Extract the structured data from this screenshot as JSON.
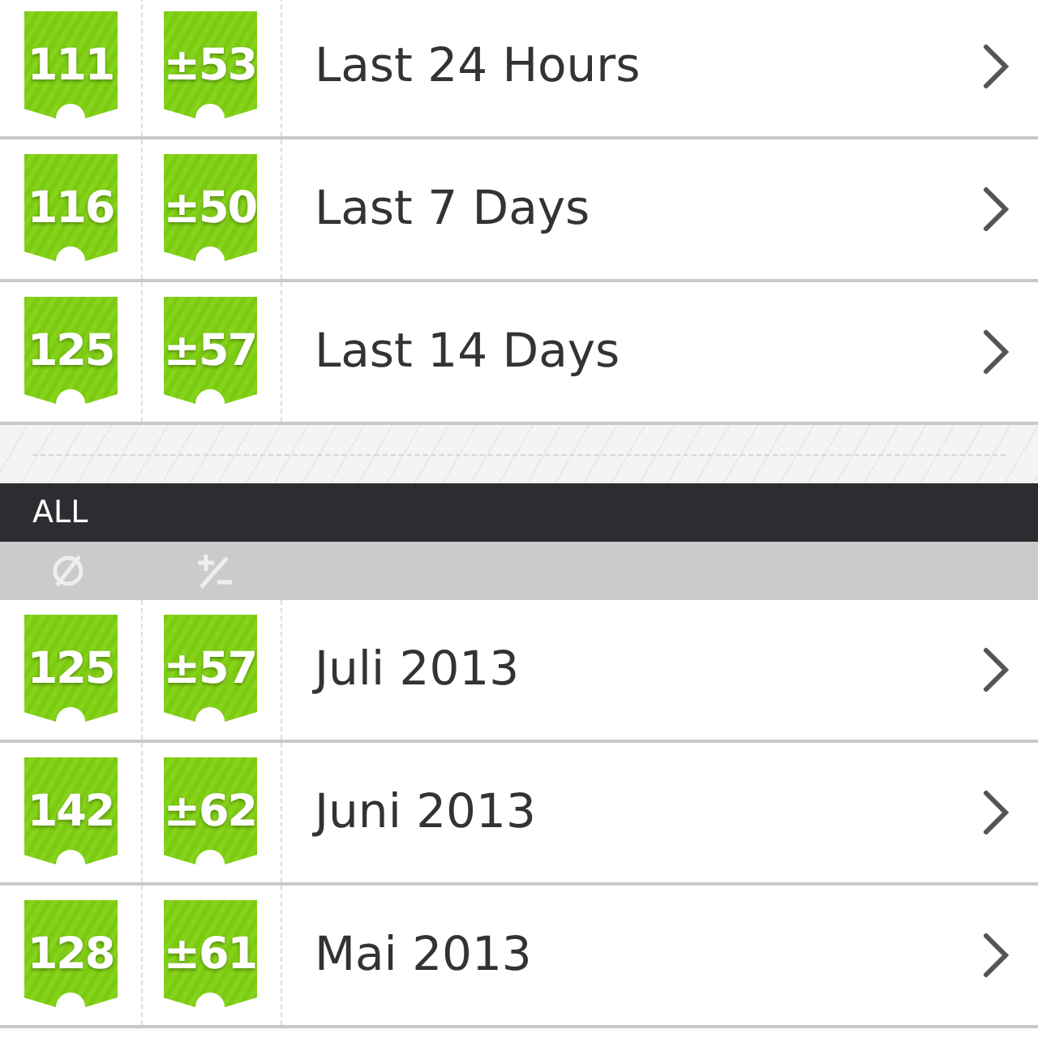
{
  "recent_rows": [
    {
      "average": "111",
      "deviation": "±53",
      "label": "Last 24 Hours"
    },
    {
      "average": "116",
      "deviation": "±50",
      "label": "Last 7 Days"
    },
    {
      "average": "125",
      "deviation": "±57",
      "label": "Last 14 Days"
    }
  ],
  "section_header": {
    "title": "ALL"
  },
  "month_rows": [
    {
      "average": "125",
      "deviation": "±57",
      "label": "Juli 2013"
    },
    {
      "average": "142",
      "deviation": "±62",
      "label": "Juni 2013"
    },
    {
      "average": "128",
      "deviation": "±61",
      "label": "Mai 2013"
    }
  ]
}
